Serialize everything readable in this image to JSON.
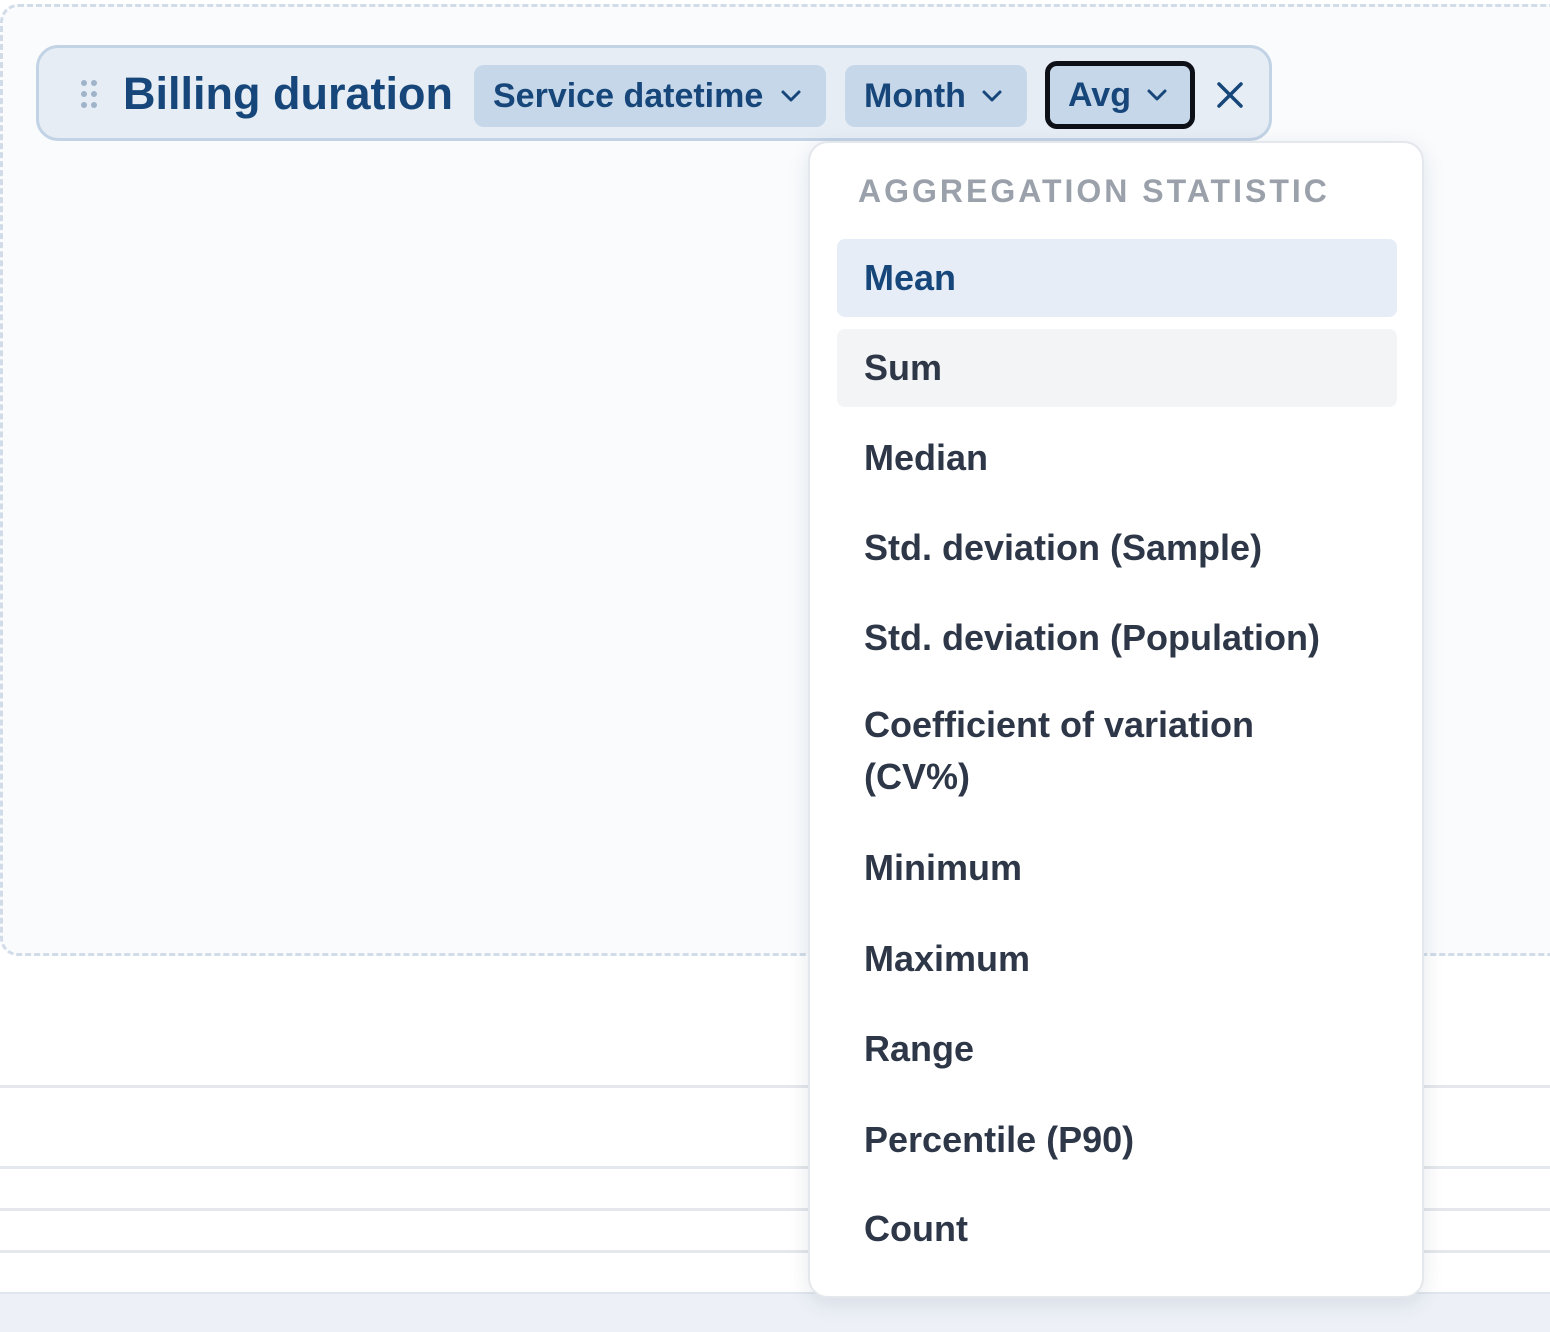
{
  "metric": {
    "title": "Billing duration",
    "filters": [
      {
        "label": "Service datetime"
      },
      {
        "label": "Month"
      }
    ],
    "aggregation": {
      "label": "Avg"
    }
  },
  "dropdown": {
    "heading": "AGGREGATION STATISTIC",
    "options": [
      {
        "label": "Mean",
        "state": "selected"
      },
      {
        "label": "Sum",
        "state": "hovered"
      },
      {
        "label": "Median"
      },
      {
        "label": "Std. deviation (Sample)"
      },
      {
        "label": "Std. deviation (Population)"
      },
      {
        "label": "Coefficient of variation",
        "label_line2": "(CV%)"
      },
      {
        "label": "Minimum"
      },
      {
        "label": "Maximum"
      },
      {
        "label": "Range"
      },
      {
        "label": "Percentile (P90)"
      },
      {
        "label": "Count"
      }
    ]
  },
  "colors": {
    "accent": "#17477a",
    "chip_bg": "#e6edf5",
    "pill_bg": "#c5d7e8",
    "selected_bg": "#e6edf6",
    "hover_bg": "#f2f4f6",
    "text": "#2e3747",
    "muted": "#9aa1aa"
  },
  "icons": {
    "drag": "drag-handle-icon",
    "chevron": "chevron-down-icon",
    "close": "close-icon"
  }
}
